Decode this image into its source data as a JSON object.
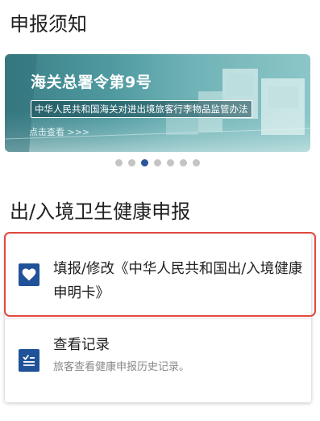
{
  "notice": {
    "title": "申报须知",
    "banner": {
      "title": "海关总署令第9号",
      "subtitle": "中华人民共和国海关对进出境旅客行李物品监管办法",
      "more": "点击查看 >>>"
    },
    "carousel": {
      "count": 7,
      "active_index": 2
    }
  },
  "health": {
    "title": "出/入境卫生健康申报",
    "fill_card": {
      "label": "填报/修改《中华人民共和国出/入境健康申明卡》",
      "icon": "heart-icon"
    },
    "history_card": {
      "label": "查看记录",
      "description": "旅客查看健康申报历史记录。",
      "icon": "record-list-icon"
    }
  },
  "colors": {
    "primary": "#1f5298",
    "highlight": "#e2483f",
    "dot_inactive": "#c4c4c4",
    "dot_active": "#2a5599",
    "muted_text": "#8a8a8a"
  }
}
